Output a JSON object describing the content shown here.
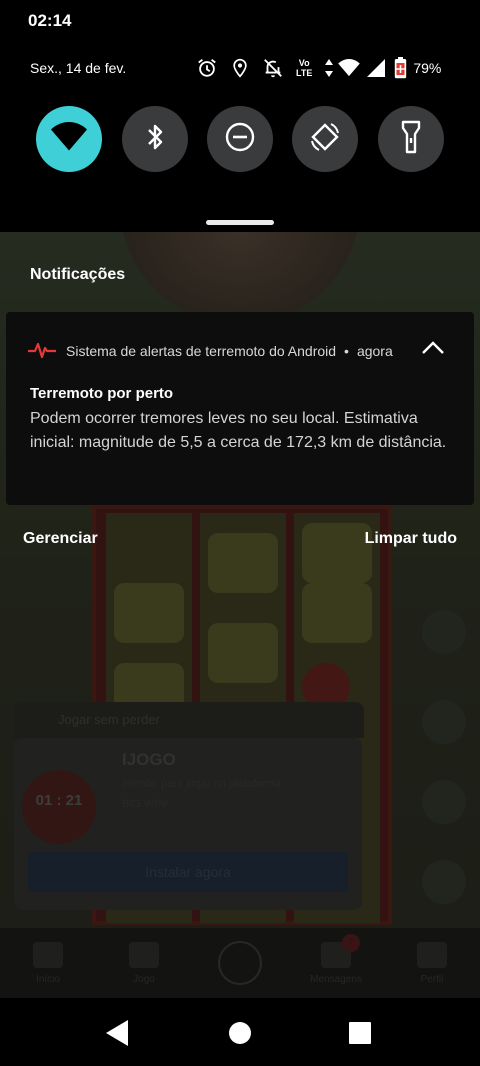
{
  "status_bar": {
    "time": "02:14",
    "date": "Sex., 14 de fev.",
    "battery_percent": "79%",
    "icons": [
      "alarm-icon",
      "location-icon",
      "notifications-off-icon",
      "volte-lte-icon",
      "data-arrows-icon",
      "wifi-signal-icon",
      "cell-signal-icon",
      "battery-icon"
    ],
    "lte_label_top": "Vo",
    "lte_label_bottom": "LTE"
  },
  "quick_settings": {
    "tiles": [
      {
        "name": "wifi",
        "icon": "wifi-icon",
        "active": true
      },
      {
        "name": "bluetooth",
        "icon": "bluetooth-icon",
        "active": false
      },
      {
        "name": "do-not-disturb",
        "icon": "dnd-icon",
        "active": false
      },
      {
        "name": "auto-rotate",
        "icon": "rotate-icon",
        "active": false
      },
      {
        "name": "flashlight",
        "icon": "flashlight-icon",
        "active": false
      }
    ],
    "accent_color": "#3ed0d6"
  },
  "notifications": {
    "heading": "Notificações",
    "items": [
      {
        "app_name": "Sistema de alertas de terremoto do Android",
        "separator": "•",
        "time": "agora",
        "title": "Terremoto por perto",
        "body": "Podem ocorrer tremores leves no seu local. Estimativa inicial: magnitude de 5,5 a cerca de 172,3 km de distância.",
        "icon": "earthquake-pulse-icon",
        "icon_color": "#e53935"
      }
    ],
    "manage_label": "Gerenciar",
    "clear_all_label": "Limpar tudo"
  },
  "background_app": {
    "ad_header": "Jogar sem perder",
    "ad_title": "IJOGO",
    "ad_subtitle": "Instalar para jogar na plataforma",
    "ad_subtitle2": "BIG WIN!",
    "ad_timer": "01 : 21",
    "ad_button": "Instalar agora",
    "tabs": [
      {
        "label": "Início",
        "icon": "home-icon"
      },
      {
        "label": "Jogo",
        "icon": "gamepad-icon"
      },
      {
        "label": "",
        "icon": "plus-icon"
      },
      {
        "label": "Mensagens",
        "icon": "bell-icon"
      },
      {
        "label": "Perfil",
        "icon": "profile-icon"
      }
    ],
    "messages_badge": "7"
  },
  "navigation_bar": {
    "buttons": [
      "back-icon",
      "home-icon",
      "recents-icon"
    ]
  }
}
